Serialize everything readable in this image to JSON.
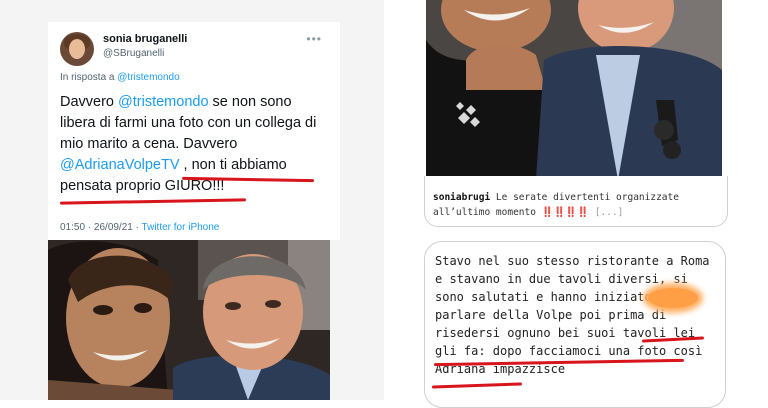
{
  "tweet": {
    "author_name": "sonia bruganelli",
    "author_handle": "@SBruganelli",
    "more_icon": "ellipsis-icon",
    "reply_prefix": "In risposta a ",
    "reply_mention": "@tristemondo",
    "text": {
      "p1": "Davvero ",
      "m1": "@tristemondo",
      "p2": " se non sono libera di farmi una foto con un collega di mio marito a cena. Davvero ",
      "m2": "@AdrianaVolpeTV",
      "p3": " , non ti abbiamo pensata proprio GIURO!!!"
    },
    "time": "01:50 · 26/09/21 · ",
    "source": "Twitter for iPhone"
  },
  "instagram": {
    "caption_user": "soniabrugi",
    "caption_text": " Le serate divertenti organizzate all’ultimo momento ",
    "caption_emphasis": "‼️‼️‼️‼️",
    "caption_more": " [...]",
    "comment": "Stavo nel suo stesso ristorante a Roma e stavano in due tavoli diversi, si sono salutati e hanno iniziato a parlare della Volpe poi prima di risedersi ognuno bei suoi tavoli lei gli fa: dopo facciamoci una foto così Adriana impazzisce"
  },
  "colors": {
    "link": "#1d9bf0",
    "underline": "#d8141c",
    "redaction": "#ff9f45"
  }
}
